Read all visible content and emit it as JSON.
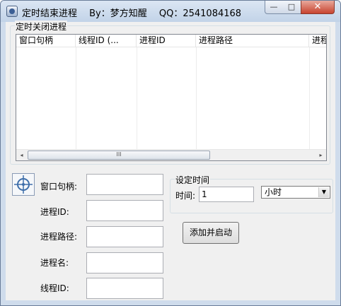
{
  "window": {
    "title": "定时结束进程　 By：梦方知醒　 QQ：2541084168",
    "min_glyph": "—",
    "max_glyph": "□",
    "close_glyph": "✕"
  },
  "process_group": {
    "title": "定时关闭进程",
    "columns": [
      "窗口句柄",
      "线程ID (...",
      "进程ID",
      "进程路径",
      "进程"
    ],
    "scroll_left_glyph": "◂",
    "scroll_right_glyph": "▸",
    "scroll_grip_glyph": "III"
  },
  "fields": {
    "window_handle_label": "窗口句柄:",
    "process_id_label": "进程ID:",
    "process_path_label": "进程路径:",
    "process_name_label": "进程名:",
    "thread_id_label": "线程ID:"
  },
  "timer": {
    "title": "设定时间",
    "time_label": "时间:",
    "time_value": "1",
    "unit_selected": "小时",
    "unit_arrow": "▼"
  },
  "action": {
    "start_label": "添加并启动"
  }
}
